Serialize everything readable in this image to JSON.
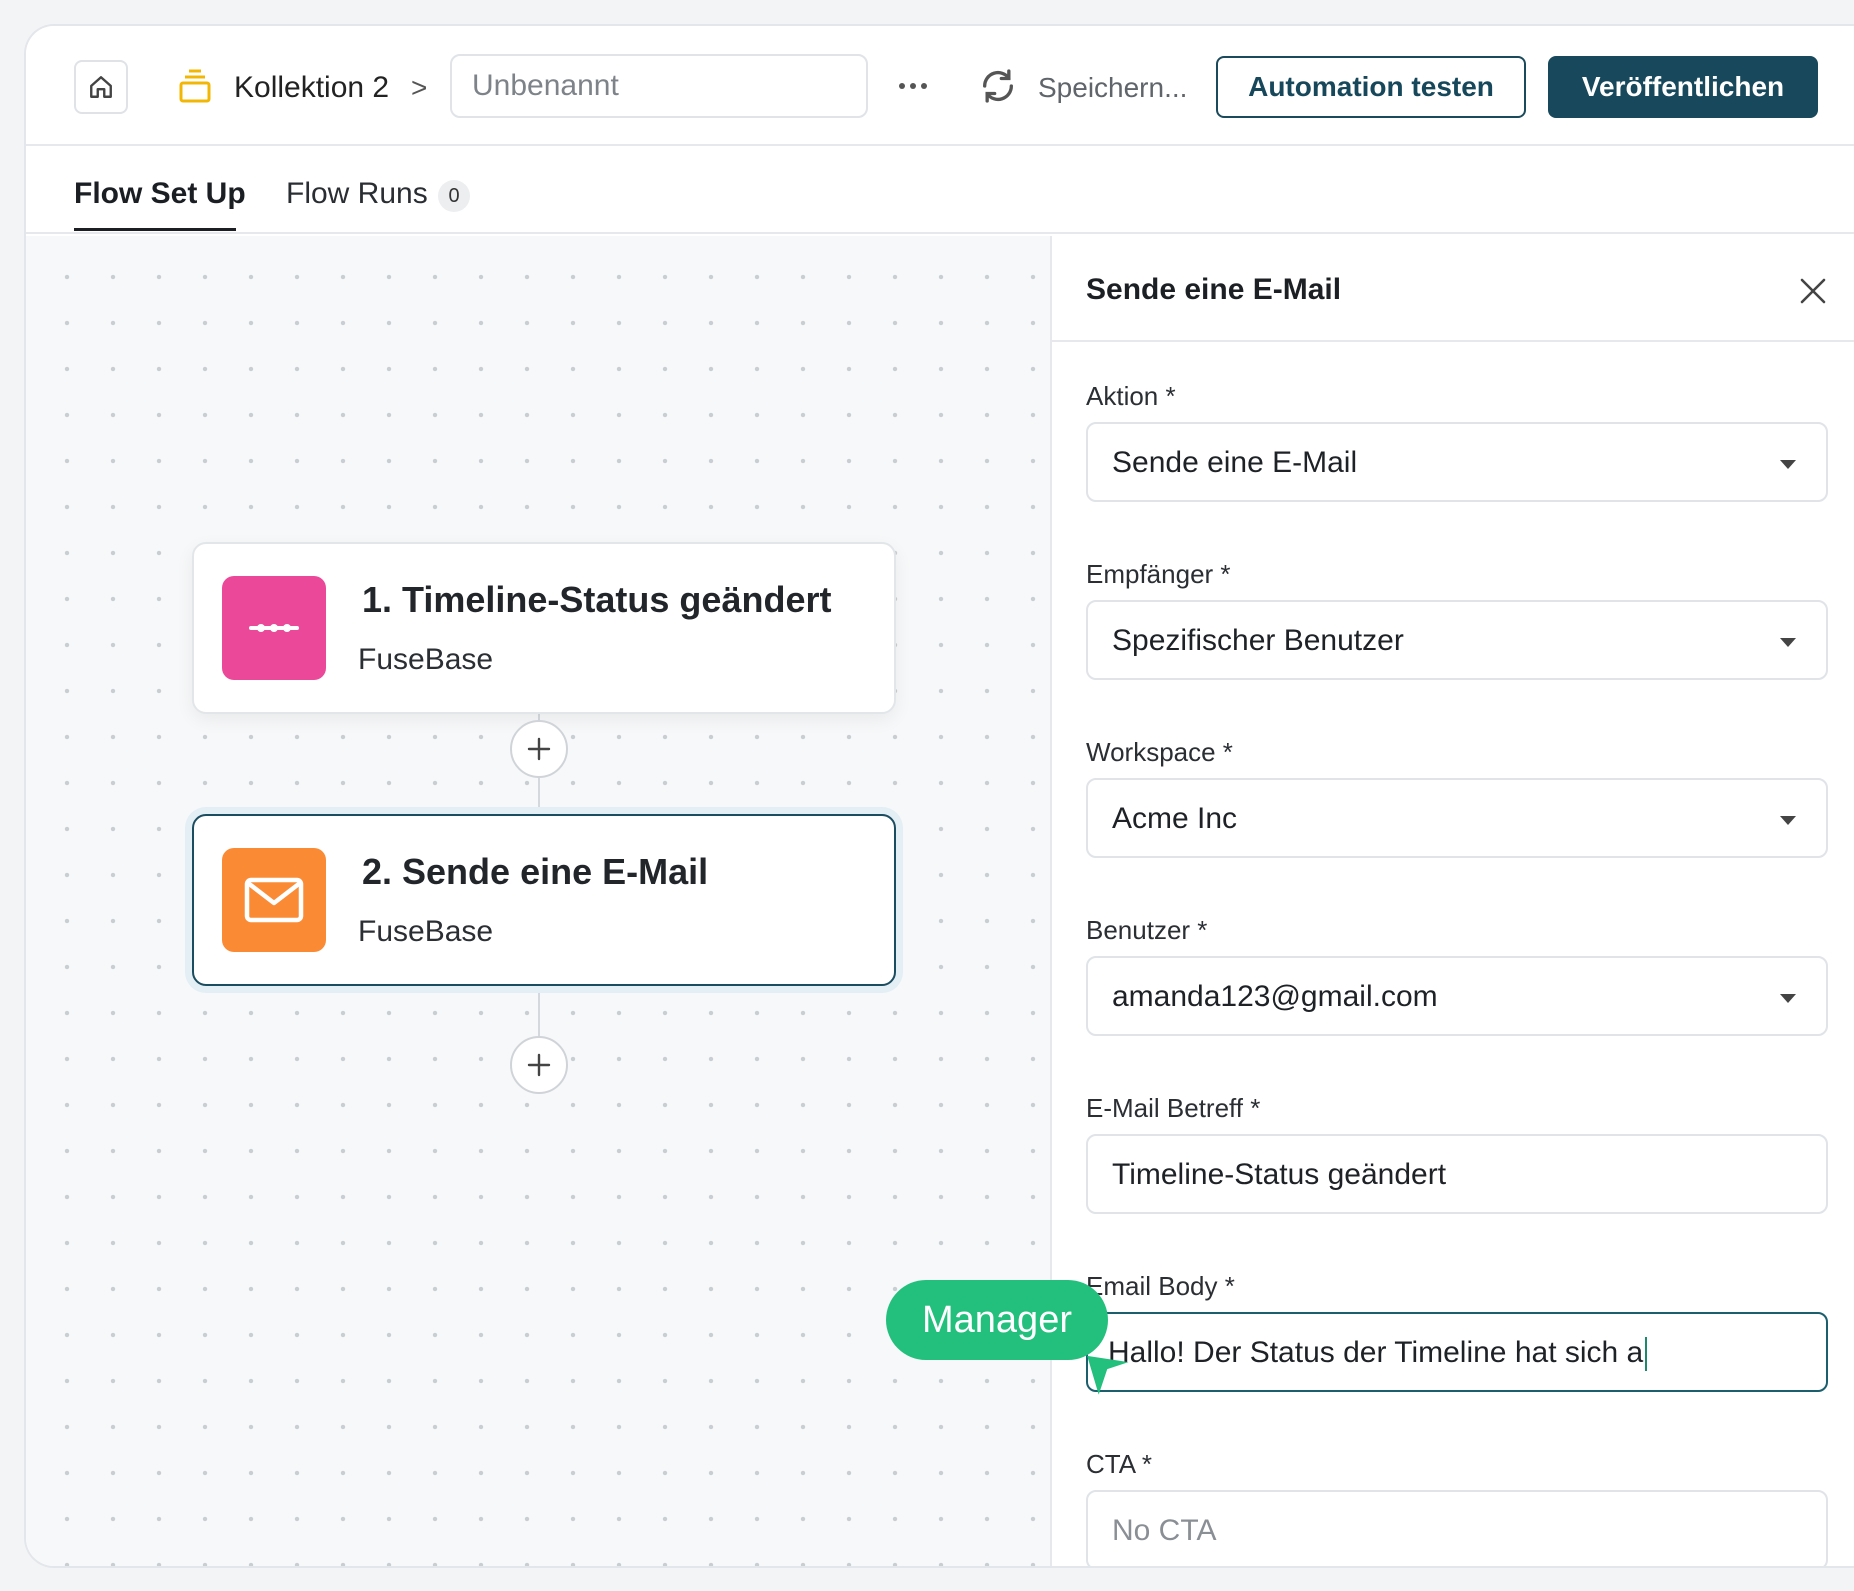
{
  "header": {
    "collection": "Kollektion 2",
    "breadcrumb_sep": ">",
    "title_placeholder": "Unbenannt",
    "saving_label": "Speichern...",
    "test_label": "Automation testen",
    "publish_label": "Veröffentlichen"
  },
  "tabs": [
    {
      "label": "Flow Set Up"
    },
    {
      "label": "Flow Runs",
      "badge": "0"
    }
  ],
  "flow": {
    "nodes": [
      {
        "title": "1. Timeline-Status geändert",
        "subtitle": "FuseBase",
        "icon": "timeline-icon",
        "color": "#ec4899"
      },
      {
        "title": "2. Sende eine E-Mail",
        "subtitle": "FuseBase",
        "icon": "mail-icon",
        "color": "#fb8a34"
      }
    ]
  },
  "panel": {
    "title": "Sende eine E-Mail",
    "fields": [
      {
        "label": "Aktion  *",
        "value": "Sende eine E-Mail"
      },
      {
        "label": "Empfänger  *",
        "value": "Spezifischer Benutzer"
      },
      {
        "label": "Workspace  *",
        "value": "Acme Inc"
      },
      {
        "label": "Benutzer  *",
        "value": "amanda123@gmail.com"
      },
      {
        "label": "E-Mail  Betreff  *",
        "value": "Timeline-Status geändert"
      },
      {
        "label": "Email Body  *",
        "value": "Hallo! Der Status der Timeline hat sich a"
      },
      {
        "label": "CTA  *",
        "placeholder": "No CTA"
      }
    ]
  },
  "cursor_tag": {
    "label": "Manager",
    "color": "#22c07c"
  },
  "colors": {
    "primary": "#17485c",
    "accent": "#22c07c"
  }
}
